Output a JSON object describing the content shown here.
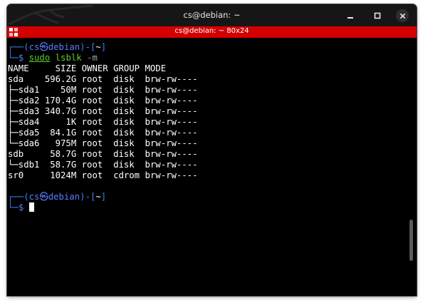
{
  "window": {
    "title": "cs@debian: ~"
  },
  "tab": {
    "title": "cs@debian: ~ 80x24"
  },
  "scrollbar": {
    "position_fraction": 0.84,
    "visible_fraction": 0.16
  },
  "colors": {
    "background": "#000000",
    "tabbar": "#d40000",
    "prompt_frame": "#3b82f6",
    "prompt_user": "#5a7bff",
    "prompt_dir": "#ffffff",
    "command": "#5ccf2e"
  },
  "prompt1": {
    "frame_top": "┌──(",
    "user": "cs",
    "at": "㉿",
    "host": "debian",
    "close_user": ")-[",
    "dir": "~",
    "close_dir": "]",
    "frame_bottom": "└─",
    "dollar": "$ ",
    "cmd": "sudo",
    "arg": "lsblk",
    "flag": "-m"
  },
  "output": [
    "NAME     SIZE OWNER GROUP MODE",
    "sda    596.2G root  disk  brw-rw----",
    "├─sda1    50M root  disk  brw-rw----",
    "├─sda2 170.4G root  disk  brw-rw----",
    "├─sda3 340.7G root  disk  brw-rw----",
    "├─sda4     1K root  disk  brw-rw----",
    "├─sda5  84.1G root  disk  brw-rw----",
    "└─sda6   975M root  disk  brw-rw----",
    "sdb     58.7G root  disk  brw-rw----",
    "└─sdb1  58.7G root  disk  brw-rw----",
    "sr0     1024M root  cdrom brw-rw----"
  ],
  "prompt2": {
    "frame_top": "┌──(",
    "user": "cs",
    "at": "㉿",
    "host": "debian",
    "close_user": ")-[",
    "dir": "~",
    "close_dir": "]",
    "frame_bottom": "└─",
    "dollar": "$ "
  }
}
